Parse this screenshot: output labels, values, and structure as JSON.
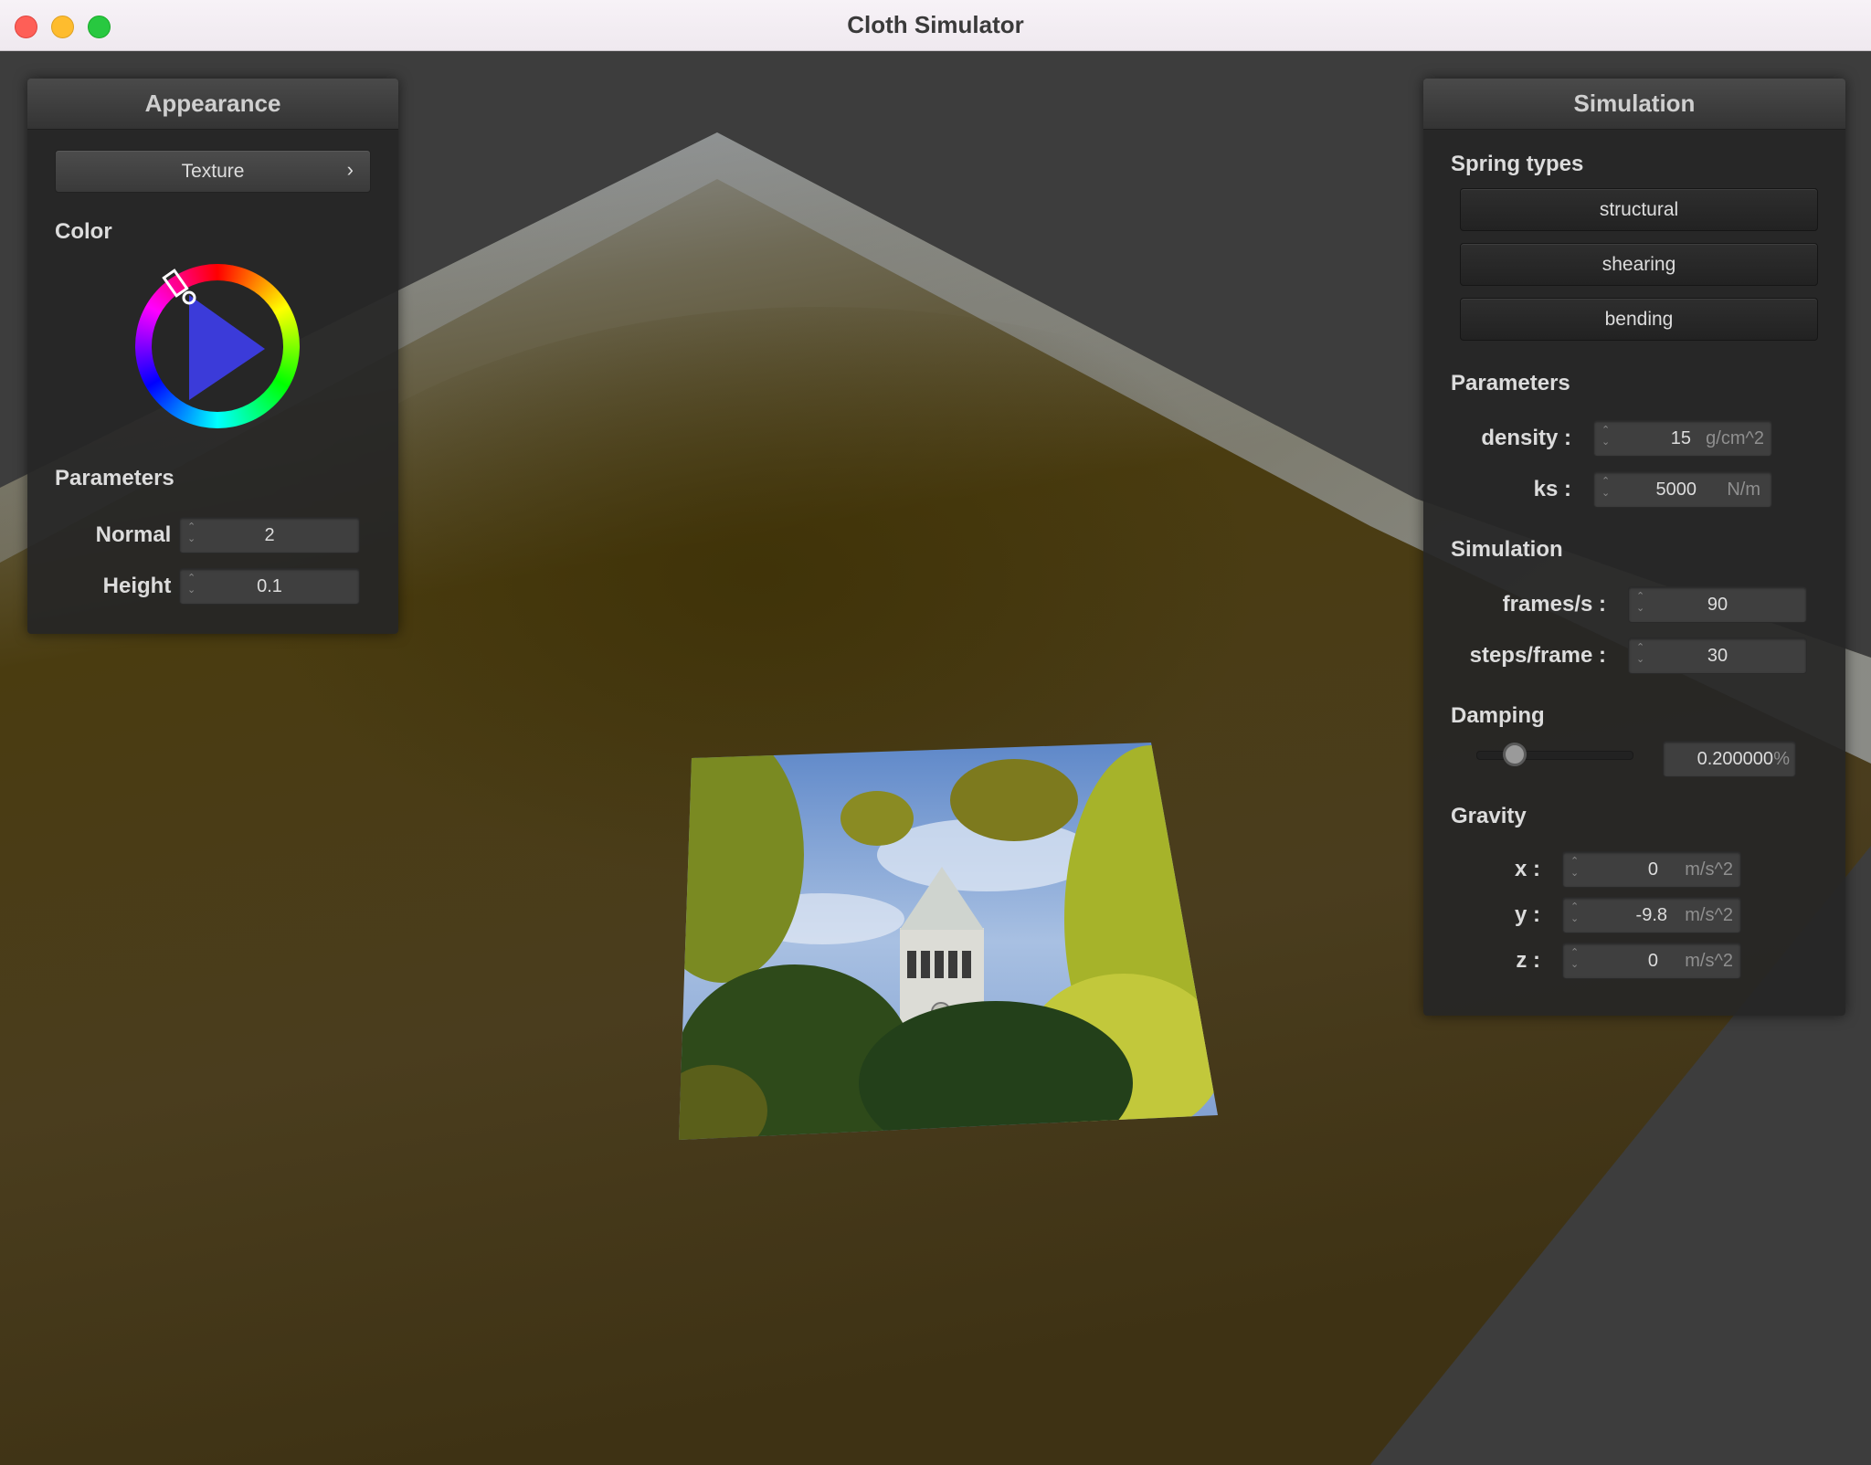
{
  "window": {
    "title": "Cloth Simulator"
  },
  "appearance": {
    "header": "Appearance",
    "texture_button": "Texture",
    "texture_chevron": "›",
    "color_label": "Color",
    "params_label": "Parameters",
    "normal": {
      "label": "Normal :",
      "value": "2"
    },
    "height": {
      "label": "Height :",
      "value": "0.1"
    }
  },
  "simulation": {
    "header": "Simulation",
    "spring_types_label": "Spring types",
    "springs": [
      "structural",
      "shearing",
      "bending"
    ],
    "params_label": "Parameters",
    "density": {
      "label": "density :",
      "value": "15",
      "unit": "g/cm^2"
    },
    "ks": {
      "label": "ks :",
      "value": "5000",
      "unit": "N/m"
    },
    "sim_label": "Simulation",
    "fps": {
      "label": "frames/s :",
      "value": "90"
    },
    "steps": {
      "label": "steps/frame :",
      "value": "30"
    },
    "damping_label": "Damping",
    "damping": {
      "value": "0.200000",
      "unit": "%",
      "slider_fraction": 0.2
    },
    "gravity_label": "Gravity",
    "gx": {
      "label": "x :",
      "value": "0",
      "unit": "m/s^2"
    },
    "gy": {
      "label": "y :",
      "value": "-9.8",
      "unit": "m/s^2"
    },
    "gz": {
      "label": "z :",
      "value": "0",
      "unit": "m/s^2"
    }
  },
  "colors": {
    "selected_hue": "#3b3bd9",
    "cloth": "#4a3d18",
    "panel": "#262626"
  }
}
